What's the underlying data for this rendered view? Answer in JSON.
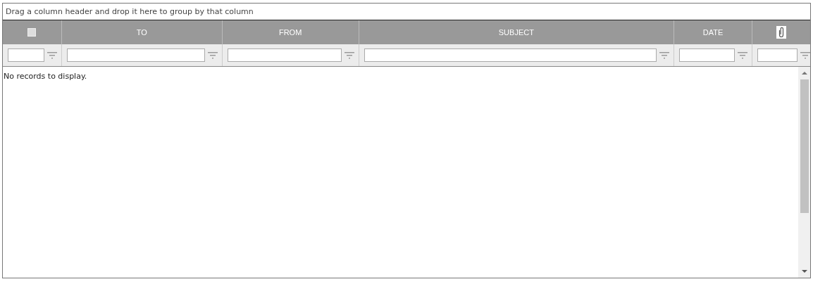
{
  "group_panel": {
    "hint": "Drag a column header and drop it here to group by that column"
  },
  "table": {
    "columns": [
      {
        "kind": "checkbox",
        "checked": false
      },
      {
        "kind": "text",
        "label": "TO"
      },
      {
        "kind": "text",
        "label": "FROM"
      },
      {
        "kind": "text",
        "label": "SUBJECT"
      },
      {
        "kind": "text",
        "label": "DATE"
      },
      {
        "kind": "attachment"
      }
    ],
    "empty_message": "No records to display."
  }
}
